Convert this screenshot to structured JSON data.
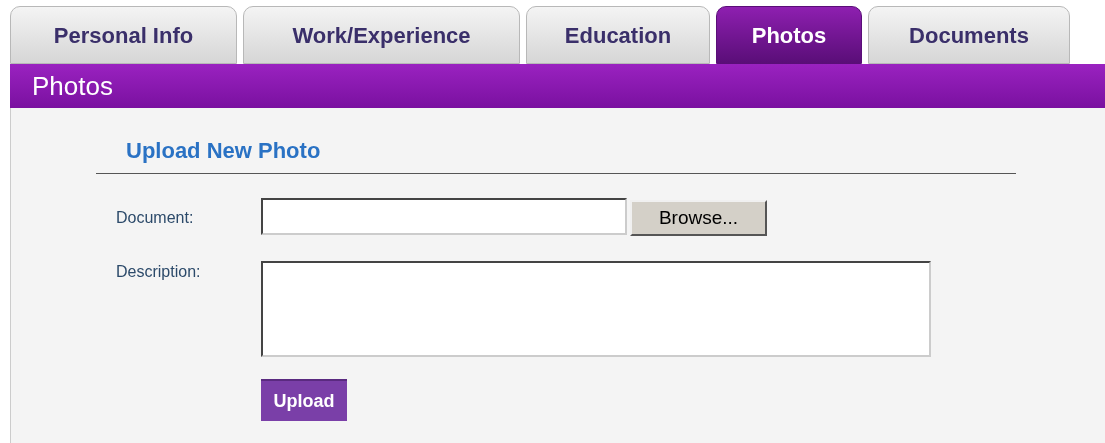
{
  "tabs": [
    {
      "label": "Personal Info",
      "selected": false
    },
    {
      "label": "Work/Experience",
      "selected": false
    },
    {
      "label": "Education",
      "selected": false
    },
    {
      "label": "Photos",
      "selected": true
    },
    {
      "label": "Documents",
      "selected": false
    }
  ],
  "section_title": "Photos",
  "form": {
    "heading": "Upload New Photo",
    "document_label": "Document:",
    "browse_button": "Browse...",
    "description_label": "Description:",
    "submit_button": "Upload"
  }
}
